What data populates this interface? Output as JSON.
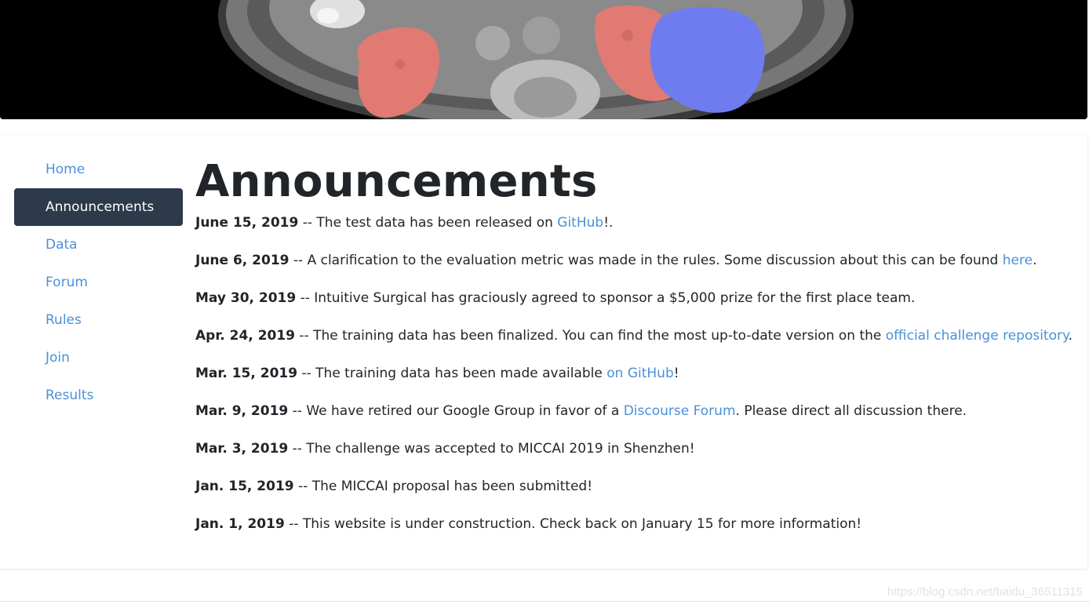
{
  "nav": {
    "items": [
      {
        "label": "Home",
        "active": false
      },
      {
        "label": "Announcements",
        "active": true
      },
      {
        "label": "Data",
        "active": false
      },
      {
        "label": "Forum",
        "active": false
      },
      {
        "label": "Rules",
        "active": false
      },
      {
        "label": "Join",
        "active": false
      },
      {
        "label": "Results",
        "active": false
      }
    ]
  },
  "page": {
    "title": "Announcements"
  },
  "announcements": [
    {
      "date": "June 15, 2019",
      "t1": " -- The test data has been released on ",
      "link": "GitHub",
      "t2": "!."
    },
    {
      "date": "June 6, 2019",
      "t1": " -- A clarification to the evaluation metric was made in the rules. Some discussion about this can be found ",
      "link": "here",
      "t2": "."
    },
    {
      "date": "May 30, 2019",
      "t1": " -- Intuitive Surgical has graciously agreed to sponsor a $5,000 prize for the first place team.",
      "link": "",
      "t2": ""
    },
    {
      "date": "Apr. 24, 2019",
      "t1": " -- The training data has been finalized. You can find the most up-to-date version on the ",
      "link": "official challenge repository",
      "t2": "."
    },
    {
      "date": "Mar. 15, 2019",
      "t1": " -- The training data has been made available ",
      "link": "on GitHub",
      "t2": "!"
    },
    {
      "date": "Mar. 9, 2019",
      "t1": " -- We have retired our Google Group in favor of a ",
      "link": "Discourse Forum",
      "t2": ". Please direct all discussion there."
    },
    {
      "date": "Mar. 3, 2019",
      "t1": " -- The challenge was accepted to MICCAI 2019 in Shenzhen!",
      "link": "",
      "t2": ""
    },
    {
      "date": "Jan. 15, 2019",
      "t1": " -- The MICCAI proposal has been submitted!",
      "link": "",
      "t2": ""
    },
    {
      "date": "Jan. 1, 2019",
      "t1": " -- This website is under construction. Check back on January 15 for more information!",
      "link": "",
      "t2": ""
    }
  ],
  "watermark": "https://blog.csdn.net/baidu_36511315",
  "colors": {
    "link": "#4a90d9",
    "nav_active_bg": "#2c3a4b",
    "kidney_overlay": "#e07a72",
    "tumor_overlay": "#6f7cf0"
  }
}
